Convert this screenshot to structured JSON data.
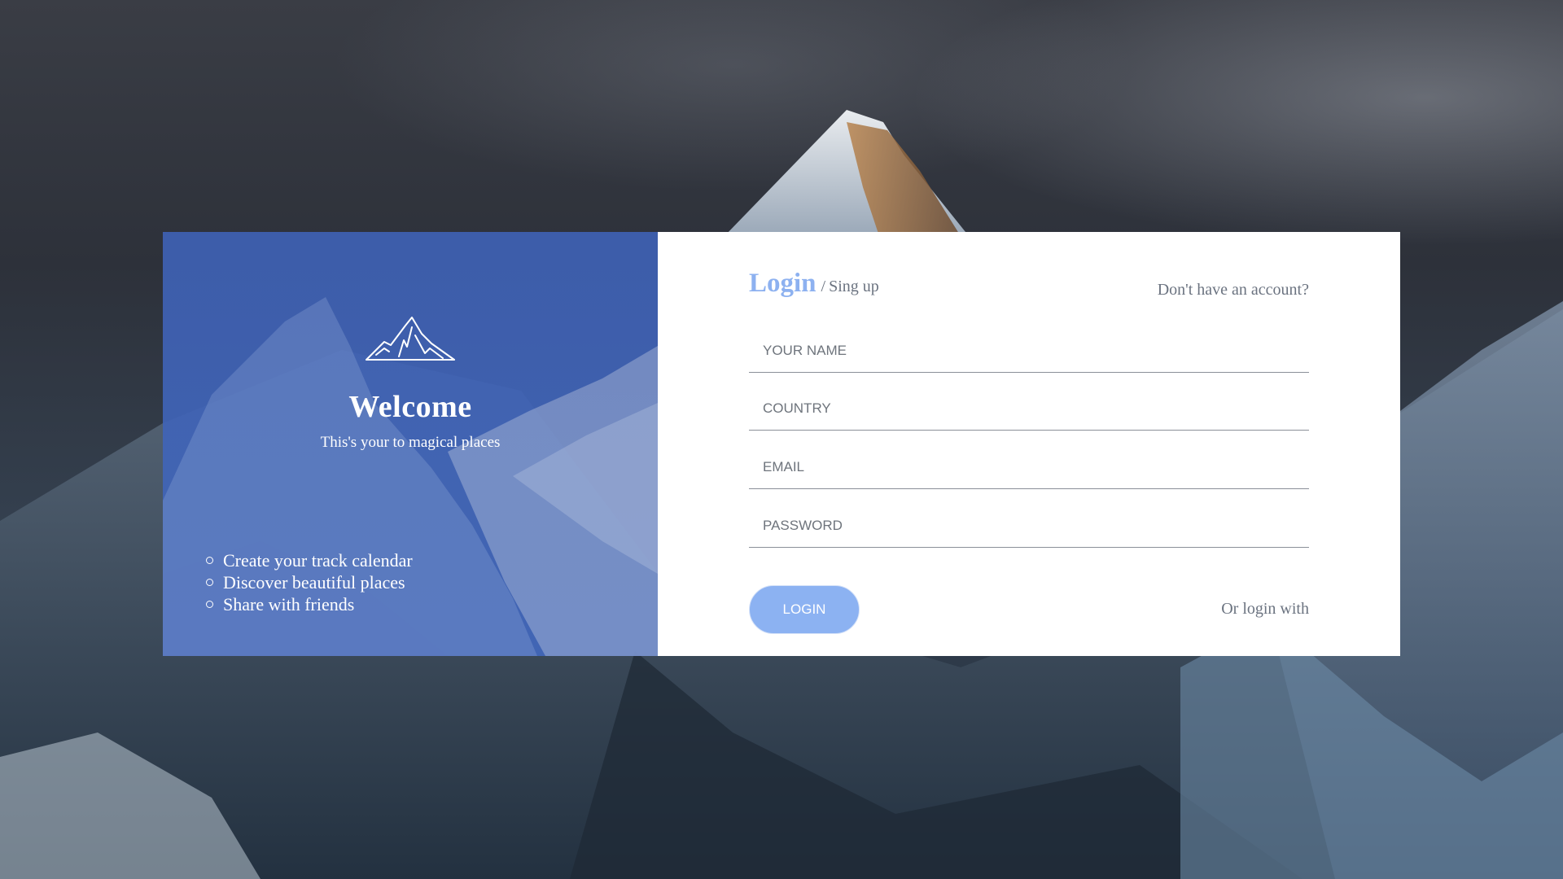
{
  "page": {
    "background_scene": "mountain-landscape"
  },
  "left_panel": {
    "icon": "mountain-icon",
    "title": "Welcome",
    "tagline": "This's your to magical places",
    "features": [
      "Create your track calendar",
      "Discover beautiful places",
      "Share with friends"
    ],
    "color": "#3e60b2"
  },
  "auth": {
    "tab_login": "Login",
    "tab_separator": "/",
    "tab_signup": "Sing up",
    "no_account": "Don't have an account?",
    "fields": {
      "name_placeholder": "YOUR NAME",
      "country_placeholder": "COUNTRY",
      "email_placeholder": "EMAIL",
      "password_placeholder": "PASSWORD"
    },
    "login_button": "LOGIN",
    "or_login_with": "Or login with",
    "accent": "#8cb2f2"
  }
}
